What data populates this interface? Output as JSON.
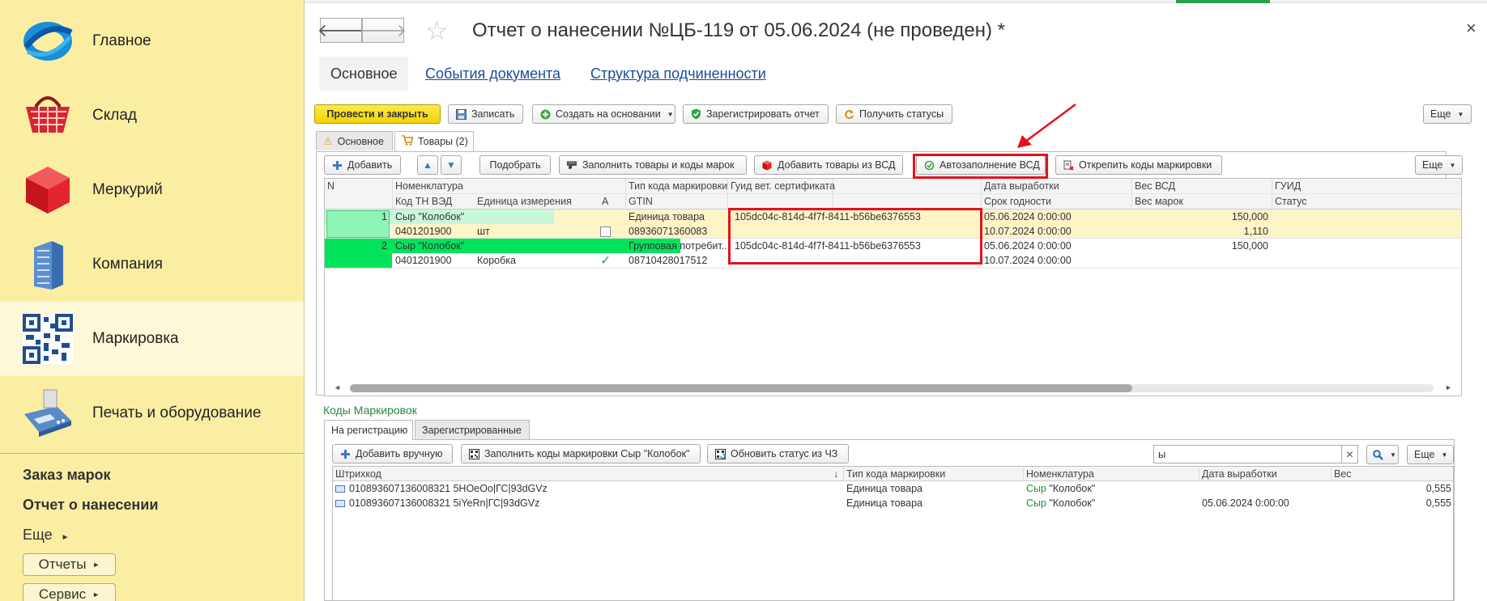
{
  "sidebar": {
    "items": [
      {
        "label": "Главное",
        "icon": "globe-logo-icon"
      },
      {
        "label": "Склад",
        "icon": "basket-icon"
      },
      {
        "label": "Меркурий",
        "icon": "cube-icon"
      },
      {
        "label": "Компания",
        "icon": "building-icon"
      },
      {
        "label": "Маркировка",
        "icon": "qr-code-icon"
      },
      {
        "label": "Печать и оборудование",
        "icon": "pos-terminal-icon"
      }
    ],
    "active_index": 4,
    "sublinks": [
      "Заказ марок",
      "Отчет о нанесении"
    ],
    "more_label": "Еще",
    "buttons": [
      "Отчеты",
      "Сервис"
    ]
  },
  "header": {
    "title": "Отчет о нанесении №ЦБ-119 от 05.06.2024 (не проведен) *",
    "back_icon": "arrow-left-icon",
    "forward_icon": "arrow-right-icon",
    "close_glyph": "×"
  },
  "doc_tabs": {
    "main": "Основное",
    "events": "События документа",
    "structure": "Структура подчиненности"
  },
  "toolbar": {
    "post_close": "Провести и закрыть",
    "save": "Записать",
    "create_based": "Создать на основании",
    "register_report": "Зарегистрировать отчет",
    "get_statuses": "Получить статусы",
    "more": "Еще"
  },
  "inner_tabs": {
    "main": "Основное",
    "goods": "Товары (2)"
  },
  "goods_toolbar": {
    "add": "Добавить",
    "pick": "Подобрать",
    "fill_goods": "Заполнить товары и коды марок",
    "add_from_vsd": "Добавить товары из ВСД",
    "autofill_vsd": "Автозаполнение ВСД",
    "unlink_codes": "Открепить коды маркировки",
    "more": "Еще"
  },
  "goods_grid": {
    "headers_row1": [
      "N",
      "Номенклатура",
      "Тип кода маркировки",
      "Гуид вет. сертификата",
      "Дата выработки",
      "Вес ВСД",
      "ГУИД"
    ],
    "headers_row2": [
      "Код ТН ВЭД",
      "Единица измерения",
      "А",
      "GTIN",
      "Срок годности",
      "Вес марок",
      "Статус"
    ],
    "rows": [
      {
        "n": "1",
        "nomenclature": "Сыр \"Колобок\"",
        "code_type": "Единица товара",
        "vet_guid": "105dc04c-814d-4f7f-8411-b56be6376553",
        "prod_date": "05.06.2024 0:00:00",
        "vsd_weight": "150,000",
        "tn_ved": "0401201900",
        "unit": "шт",
        "gtin": "08936071360083",
        "expiry": "10.07.2024 0:00:00",
        "marks_weight": "1,110",
        "a_flag": "checkbox"
      },
      {
        "n": "2",
        "nomenclature": "Сыр \"Колобок\"",
        "code_type": "Групповая потребит...",
        "vet_guid": "105dc04c-814d-4f7f-8411-b56be6376553",
        "prod_date": "05.06.2024 0:00:00",
        "vsd_weight": "150,000",
        "tn_ved": "0401201900",
        "unit": "Коробка",
        "gtin": "08710428017512",
        "expiry": "10.07.2024 0:00:00",
        "marks_weight": "",
        "a_flag": "check"
      }
    ]
  },
  "codes": {
    "title": "Коды Маркировок",
    "tabs": [
      "На регистрацию",
      "Зарегистрированные"
    ],
    "add_manual": "Добавить вручную",
    "fill_codes": "Заполнить коды маркировки Сыр \"Колобок\"",
    "update_status": "Обновить статус из ЧЗ",
    "search_value": "ы",
    "more": "Еще",
    "headers": [
      "Штрихкод",
      "Тип кода маркировки",
      "Номенклатура",
      "Дата выработки",
      "Вес"
    ],
    "sort_glyph": "↓",
    "rows": [
      {
        "barcode": "010893607136008321 5HOeOo|ГС|93dGVz",
        "type": "Единица товара",
        "nom_highlight": "Сыр",
        "nom_rest": " \"Колобок\"",
        "date": "",
        "weight": "0,555"
      },
      {
        "barcode": "010893607136008321 5iYeRn|ГС|93dGVz",
        "type": "Единица товара",
        "nom_highlight": "Сыр",
        "nom_rest": " \"Колобок\"",
        "date": "05.06.2024 0:00:00",
        "weight": "0,555"
      }
    ]
  },
  "colors": {
    "sidebar_bg": "#fbeea3",
    "primary_btn": "#f2d200",
    "selected_row": "#00e35a",
    "selected_cell": "#8ff5b6",
    "row1_bg": "#fff3c8",
    "highlight_box": "#e3121b",
    "link": "#1a4b9c",
    "codes_title": "#2a8a3c"
  }
}
